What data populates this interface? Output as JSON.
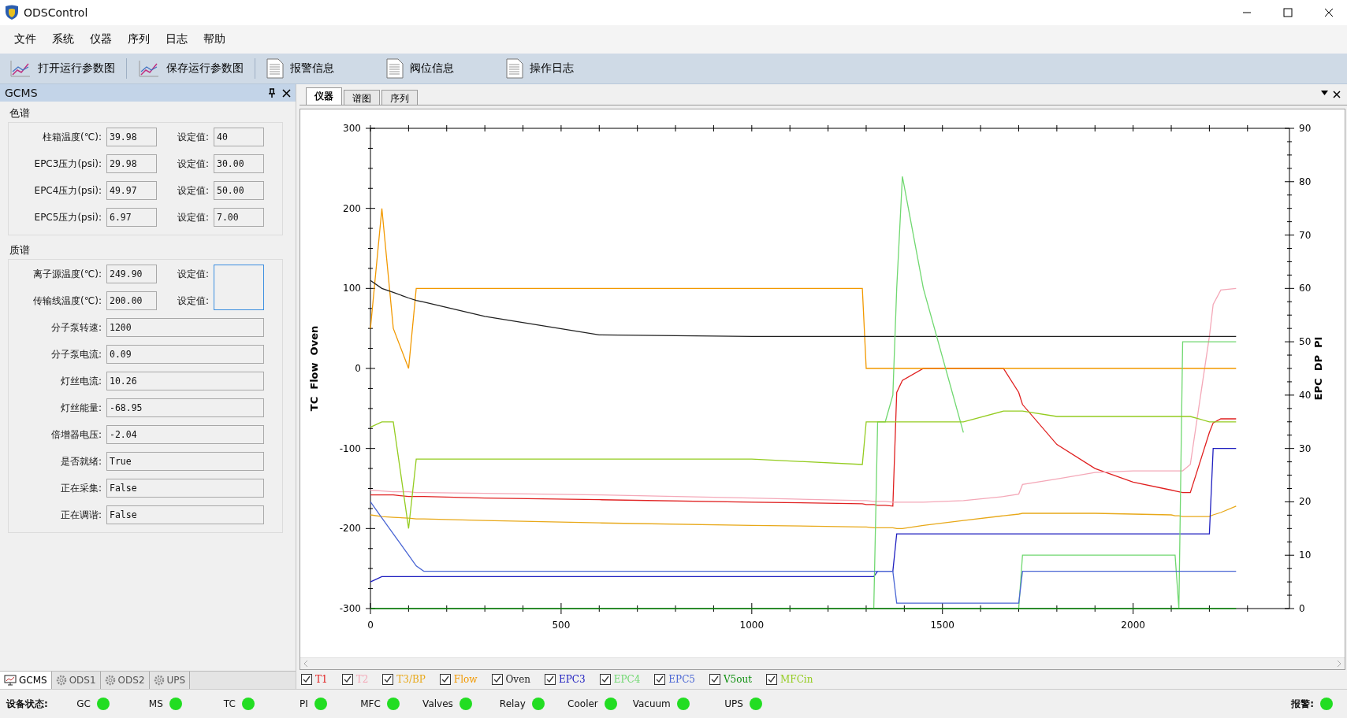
{
  "window": {
    "title": "ODSControl"
  },
  "menu": [
    "文件",
    "系统",
    "仪器",
    "序列",
    "日志",
    "帮助"
  ],
  "toolbar": [
    {
      "label": "打开运行参数图",
      "kind": "chart"
    },
    {
      "label": "保存运行参数图",
      "kind": "chart"
    },
    {
      "label": "报警信息",
      "kind": "document"
    },
    {
      "label": "阀位信息",
      "kind": "document"
    },
    {
      "label": "操作日志",
      "kind": "document"
    }
  ],
  "side_panel": {
    "title": "GCMS",
    "sections": [
      {
        "title": "色谱",
        "rows": [
          {
            "kind": "pair",
            "label": "柱箱温度(℃):",
            "value": "39.98",
            "set_label": "设定值:",
            "set_value": "40"
          },
          {
            "kind": "pair",
            "label": "EPC3压力(psi):",
            "value": "29.98",
            "set_label": "设定值:",
            "set_value": "30.00"
          },
          {
            "kind": "pair",
            "label": "EPC4压力(psi):",
            "value": "49.97",
            "set_label": "设定值:",
            "set_value": "50.00"
          },
          {
            "kind": "pair",
            "label": "EPC5压力(psi):",
            "value": "6.97",
            "set_label": "设定值:",
            "set_value": "7.00"
          }
        ]
      },
      {
        "title": "质谱",
        "shared_setpoint": {
          "focused": true
        },
        "rows": [
          {
            "kind": "shared",
            "label": "离子源温度(℃):",
            "value": "249.90",
            "set_label": "设定值:"
          },
          {
            "kind": "shared",
            "label": "传输线温度(℃):",
            "value": "200.00",
            "set_label": "设定值:"
          },
          {
            "kind": "single",
            "label": "分子泵转速:",
            "value": "1200"
          },
          {
            "kind": "single",
            "label": "分子泵电流:",
            "value": "0.09"
          },
          {
            "kind": "single",
            "label": "灯丝电流:",
            "value": "10.26"
          },
          {
            "kind": "single",
            "label": "灯丝能量:",
            "value": "-68.95"
          },
          {
            "kind": "single",
            "label": "倍增器电压:",
            "value": "-2.04"
          },
          {
            "kind": "single",
            "label": "是否就绪:",
            "value": "True"
          },
          {
            "kind": "single",
            "label": "正在采集:",
            "value": "False"
          },
          {
            "kind": "single",
            "label": "正在调谐:",
            "value": "False"
          }
        ]
      }
    ],
    "tabs": [
      {
        "label": "GCMS",
        "selected": true,
        "kind": "monitor"
      },
      {
        "label": "ODS1",
        "selected": false,
        "kind": "gear"
      },
      {
        "label": "ODS2",
        "selected": false,
        "kind": "gear"
      },
      {
        "label": "UPS",
        "selected": false,
        "kind": "gear"
      }
    ]
  },
  "doc_tabs": [
    {
      "label": "仪器",
      "selected": true
    },
    {
      "label": "谱图",
      "selected": false
    },
    {
      "label": "序列",
      "selected": false
    }
  ],
  "chart_data": {
    "type": "line",
    "ylabel": "TC  Flow  Oven",
    "y2label": "EPC  DP  PI",
    "xlim": [
      0,
      2410
    ],
    "ylim": [
      -300,
      300
    ],
    "y2lim": [
      0,
      90
    ],
    "xticks": [
      0,
      500,
      1000,
      1500,
      2000
    ],
    "yticks": [
      -300,
      -200,
      -100,
      0,
      100,
      200,
      300
    ],
    "y2ticks": [
      0,
      10,
      20,
      30,
      40,
      50,
      60,
      70,
      80,
      90
    ],
    "x": [
      0,
      30,
      60,
      100,
      120,
      140,
      300,
      600,
      1000,
      1290,
      1300,
      1320,
      1330,
      1350,
      1370,
      1380,
      1395,
      1450,
      1555,
      1660,
      1700,
      1710,
      1800,
      1900,
      2000,
      2100,
      2110,
      2120,
      2130,
      2150,
      2200,
      2210,
      2230,
      2270
    ],
    "series": [
      {
        "name": "T1",
        "color": "#e02020",
        "values": [
          -158,
          -158,
          -158,
          -160,
          -160,
          -160,
          -162,
          -164,
          -167,
          -169,
          -170,
          -170,
          -171,
          -171,
          -172,
          -30,
          -15,
          0,
          0,
          0,
          -30,
          -45,
          -95,
          -125,
          -142,
          -152,
          -153,
          -154,
          -155,
          -155,
          -80,
          -68,
          -63,
          -63
        ]
      },
      {
        "name": "T2",
        "color": "#f4a8b8",
        "values": [
          -152,
          -153,
          -154,
          -154,
          -155,
          -155,
          -156,
          -158,
          -162,
          -165,
          -165,
          -166,
          -166,
          -166,
          -167,
          -167,
          -167,
          -167,
          -165,
          -160,
          -157,
          -145,
          -138,
          -130,
          -128,
          -128,
          -128,
          -128,
          -128,
          -120,
          40,
          80,
          98,
          100
        ]
      },
      {
        "name": "T3/BP",
        "color": "#e8a818",
        "values": [
          -183,
          -185,
          -186,
          -187,
          -188,
          -188,
          -190,
          -193,
          -196,
          -198,
          -198,
          -199,
          -199,
          -199,
          -199,
          -200,
          -200,
          -196,
          -190,
          -184,
          -182,
          -181,
          -181,
          -181,
          -182,
          -183,
          -184,
          -184,
          -185,
          -185,
          -185,
          -183,
          -180,
          -172
        ]
      },
      {
        "name": "Flow",
        "color": "#f29900",
        "values": [
          50,
          200,
          50,
          0,
          100,
          100,
          100,
          100,
          100,
          100,
          0,
          0,
          0,
          0,
          0,
          0,
          0,
          0,
          0,
          0,
          0,
          0,
          0,
          0,
          0,
          0,
          0,
          0,
          0,
          0,
          0,
          0,
          0,
          0
        ]
      },
      {
        "name": "Oven",
        "color": "#202020",
        "values": [
          110,
          100,
          95,
          88,
          85,
          83,
          65,
          42,
          40,
          40,
          40,
          40,
          40,
          40,
          40,
          40,
          40,
          40,
          40,
          40,
          40,
          40,
          40,
          40,
          40,
          40,
          40,
          40,
          40,
          40,
          40,
          40,
          40,
          40
        ]
      },
      {
        "name": "EPC3",
        "color": "#2020c0",
        "axis": "y2",
        "values": [
          5,
          6,
          6,
          6,
          6,
          6,
          6,
          6,
          6,
          6,
          6,
          6,
          7,
          7,
          7,
          14,
          14,
          14,
          14,
          14,
          14,
          14,
          14,
          14,
          14,
          14,
          14,
          14,
          14,
          14,
          14,
          30,
          30,
          30
        ]
      },
      {
        "name": "EPC4",
        "color": "#70d870",
        "axis": "y2",
        "values": [
          null,
          null,
          null,
          null,
          null,
          null,
          null,
          null,
          null,
          null,
          null,
          0,
          35,
          35,
          40,
          60,
          81,
          60,
          33,
          null,
          0,
          10,
          10,
          10,
          10,
          10,
          10,
          0,
          50,
          50,
          50,
          50,
          50,
          50
        ]
      },
      {
        "name": "EPC5",
        "color": "#4a66d4",
        "axis": "y2",
        "values": [
          20,
          17,
          14,
          10,
          8,
          7,
          7,
          7,
          7,
          7,
          7,
          7,
          7,
          7,
          7,
          1,
          1,
          1,
          1,
          1,
          1,
          7,
          7,
          7,
          7,
          7,
          7,
          7,
          7,
          7,
          7,
          7,
          7,
          7
        ]
      },
      {
        "name": "V5out",
        "color": "#109010",
        "axis": "y2",
        "values": [
          0,
          0,
          0,
          0,
          0,
          0,
          0,
          0,
          0,
          0,
          0,
          0,
          0,
          0,
          0,
          0,
          0,
          0,
          0,
          0,
          0,
          0,
          0,
          0,
          0,
          0,
          0,
          0,
          0,
          0,
          0,
          0,
          0,
          0
        ]
      },
      {
        "name": "MFCin",
        "color": "#94cc20",
        "axis": "y2",
        "values": [
          34,
          35,
          35,
          15,
          28,
          28,
          28,
          28,
          28,
          27,
          35,
          35,
          35,
          35,
          35,
          35,
          35,
          35,
          35,
          37,
          37,
          37,
          36,
          36,
          36,
          36,
          36,
          36,
          36,
          36,
          35,
          35,
          35,
          35
        ]
      }
    ]
  },
  "legend": [
    {
      "checked": true
    },
    {
      "checked": true
    },
    {
      "checked": true
    },
    {
      "checked": true
    },
    {
      "checked": true
    },
    {
      "checked": true
    },
    {
      "checked": true
    },
    {
      "checked": true
    },
    {
      "checked": true
    },
    {
      "checked": true
    }
  ],
  "status_bar": {
    "label": "设备状态:",
    "items": [
      {
        "label": "GC",
        "color": "#22dd22"
      },
      {
        "label": "MS",
        "color": "#22dd22"
      },
      {
        "label": "TC",
        "color": "#22dd22"
      },
      {
        "label": "PI",
        "color": "#22dd22"
      },
      {
        "label": "MFC",
        "color": "#22dd22"
      },
      {
        "label": "Valves",
        "color": "#22dd22"
      },
      {
        "label": "Relay",
        "color": "#22dd22"
      },
      {
        "label": "Cooler",
        "color": "#22dd22"
      },
      {
        "label": "Vacuum",
        "color": "#22dd22"
      },
      {
        "label": "UPS",
        "color": "#22dd22"
      }
    ],
    "alarm": {
      "label": "报警:",
      "color": "#22dd22"
    }
  }
}
